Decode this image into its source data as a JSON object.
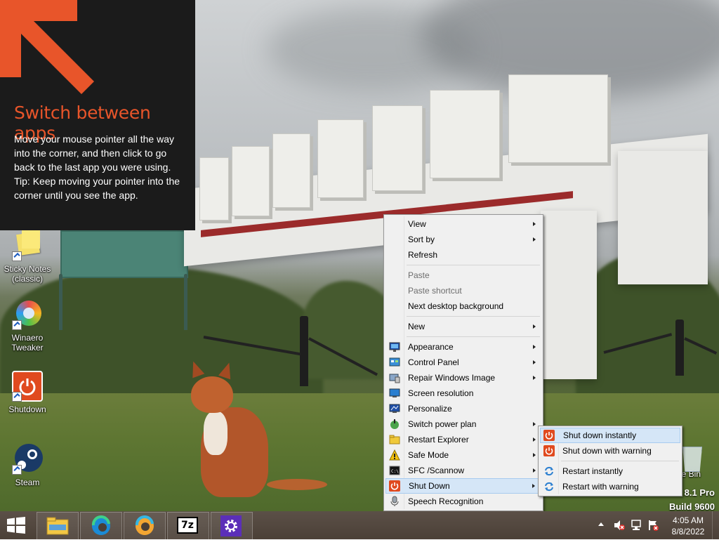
{
  "tip": {
    "title": "Switch between apps",
    "body": "Move your mouse pointer all the way into the corner, and then click to go back to the last app you were using.",
    "tip": "Tip: Keep moving your pointer into the corner until you see the app.",
    "arrow_color": "#e8552a"
  },
  "desktop_icons": [
    {
      "label": "Sticky Notes (classic)",
      "icon": "sticky-notes-icon"
    },
    {
      "label": "Winaero Tweaker",
      "icon": "winaero-tweaker-icon"
    },
    {
      "label": "Shutdown",
      "icon": "shutdown-icon"
    },
    {
      "label": "Steam",
      "icon": "steam-icon"
    },
    {
      "label": "cle Bin",
      "icon": "recycle-bin-icon"
    }
  ],
  "context_menu": {
    "items": [
      {
        "label": "View",
        "submenu": true
      },
      {
        "label": "Sort by",
        "submenu": true
      },
      {
        "label": "Refresh"
      },
      {
        "label": "Paste",
        "disabled": true
      },
      {
        "label": "Paste shortcut",
        "disabled": true
      },
      {
        "label": "Next desktop background"
      },
      {
        "label": "New",
        "submenu": true
      },
      {
        "label": "Appearance",
        "submenu": true,
        "icon": "appearance-icon"
      },
      {
        "label": "Control Panel",
        "submenu": true,
        "icon": "control-panel-icon"
      },
      {
        "label": "Repair Windows Image",
        "submenu": true,
        "icon": "repair-image-icon"
      },
      {
        "label": "Screen resolution",
        "icon": "screen-resolution-icon"
      },
      {
        "label": "Personalize",
        "icon": "personalize-icon"
      },
      {
        "label": "Switch power plan",
        "submenu": true,
        "icon": "power-plan-icon"
      },
      {
        "label": "Restart Explorer",
        "submenu": true,
        "icon": "restart-explorer-icon"
      },
      {
        "label": "Safe Mode",
        "submenu": true,
        "icon": "safe-mode-warning-icon"
      },
      {
        "label": "SFC /Scannow",
        "submenu": true,
        "icon": "command-prompt-icon"
      },
      {
        "label": "Shut Down",
        "submenu": true,
        "icon": "shutdown-icon",
        "highlighted": true
      },
      {
        "label": "Speech Recognition",
        "icon": "microphone-icon"
      }
    ]
  },
  "shutdown_submenu": {
    "items": [
      {
        "label": "Shut down instantly",
        "icon": "power-icon",
        "highlighted": true
      },
      {
        "label": "Shut down with warning",
        "icon": "power-icon"
      },
      {
        "label": "Restart instantly",
        "icon": "restart-icon"
      },
      {
        "label": "Restart with warning",
        "icon": "restart-icon"
      }
    ]
  },
  "watermark": {
    "line1": "8.1 Pro",
    "line2": "Build 9600"
  },
  "taskbar": {
    "pinned": [
      {
        "name": "file-explorer-icon"
      },
      {
        "name": "edge-icon"
      },
      {
        "name": "edge-canary-icon"
      },
      {
        "name": "7zip-icon",
        "text": "7z"
      },
      {
        "name": "settings-gear-icon"
      }
    ],
    "clock_time": "4:05 AM",
    "clock_date": "8/8/2022"
  },
  "colors": {
    "menu_bg": "#f0f0f0",
    "menu_highlight": "#d5e6f7",
    "shutdown_red": "#e04a1f",
    "tip_bg": "#1b1b1b"
  }
}
